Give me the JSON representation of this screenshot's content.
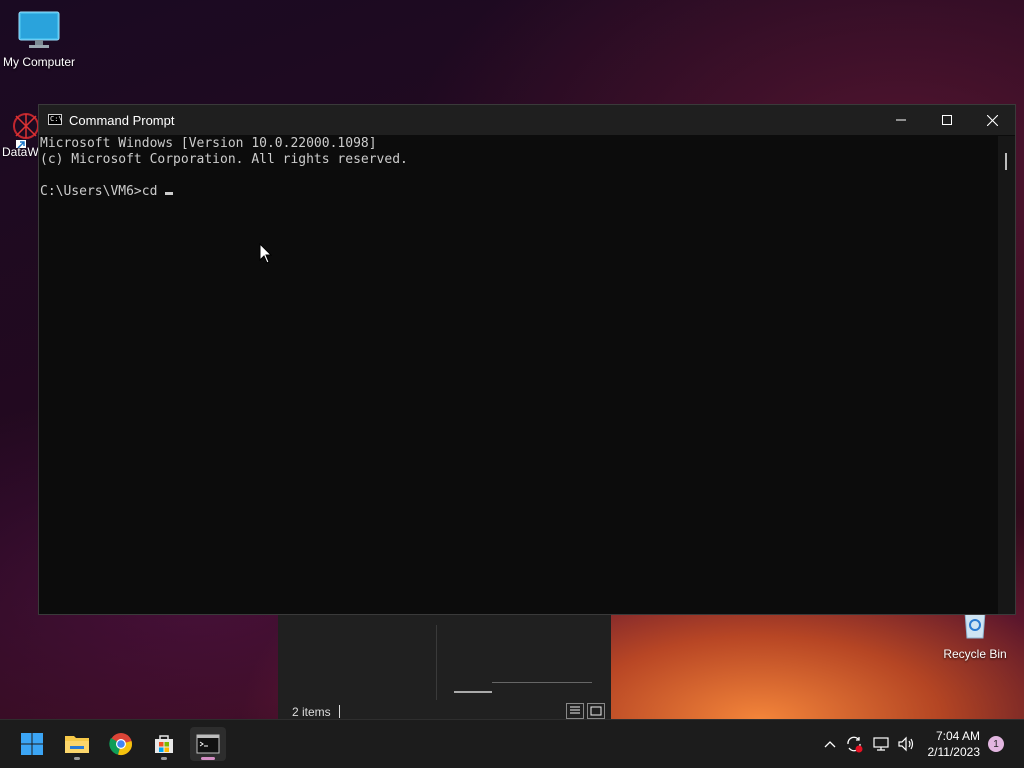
{
  "desktop": {
    "icons": {
      "my_computer": "My Computer",
      "dataw": "DataW",
      "recycle_bin": "Recycle Bin"
    }
  },
  "explorer_fragment": {
    "status_text": "2 items"
  },
  "cmd": {
    "title": "Command Prompt",
    "icon_text": "C:\\",
    "lines": [
      "Microsoft Windows [Version 10.0.22000.1098]",
      "(c) Microsoft Corporation. All rights reserved.",
      "",
      "C:\\Users\\VM6>cd "
    ]
  },
  "taskbar": {
    "clock_time": "7:04 AM",
    "clock_date": "2/11/2023",
    "notification_count": "1",
    "accent": "#d48ec4"
  }
}
